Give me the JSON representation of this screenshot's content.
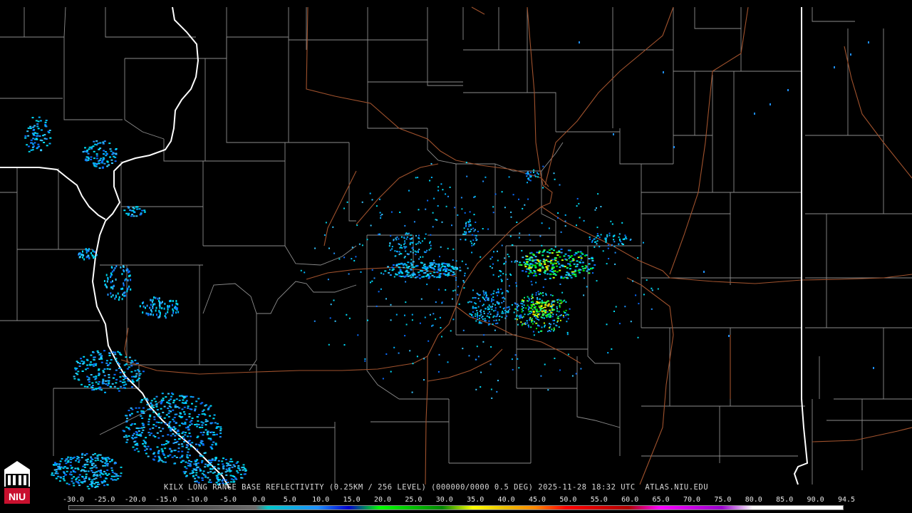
{
  "product": {
    "caption": "KILX LONG RANGE BASE REFLECTIVITY (0.25KM / 256 LEVEL) (000000/0000 0.5 DEG) 2025-11-28 18:32 UTC  ATLAS.NIU.EDU"
  },
  "logo": {
    "text": "NIU"
  },
  "legend": {
    "labels": [
      "-30.0",
      "-25.0",
      "-20.0",
      "-15.0",
      "-10.0",
      "-5.0",
      "0.0",
      "5.0",
      "10.0",
      "15.0",
      "20.0",
      "25.0",
      "30.0",
      "35.0",
      "40.0",
      "45.0",
      "50.0",
      "55.0",
      "60.0",
      "65.0",
      "70.0",
      "75.0",
      "80.0",
      "85.0",
      "90.0",
      "94.5"
    ],
    "stops": [
      {
        "value": -30,
        "color": "#1a1a1a"
      },
      {
        "value": 0,
        "color": "#6b6b6b"
      },
      {
        "value": 2,
        "color": "#00c8c8"
      },
      {
        "value": 10,
        "color": "#1e90ff"
      },
      {
        "value": 15,
        "color": "#0000d0"
      },
      {
        "value": 20,
        "color": "#00ff00"
      },
      {
        "value": 30,
        "color": "#008800"
      },
      {
        "value": 35,
        "color": "#ffff00"
      },
      {
        "value": 40,
        "color": "#e8c000"
      },
      {
        "value": 45,
        "color": "#ff8800"
      },
      {
        "value": 50,
        "color": "#ff0000"
      },
      {
        "value": 60,
        "color": "#b00000"
      },
      {
        "value": 65,
        "color": "#ff00ff"
      },
      {
        "value": 75,
        "color": "#9900cc"
      },
      {
        "value": 80,
        "color": "#ffffff"
      },
      {
        "value": 94.5,
        "color": "#ffffff"
      }
    ]
  },
  "colors": {
    "background": "#000000",
    "state_border": "#ffffff",
    "county_border": "#8c8c8c",
    "highway": "#a0522d"
  }
}
